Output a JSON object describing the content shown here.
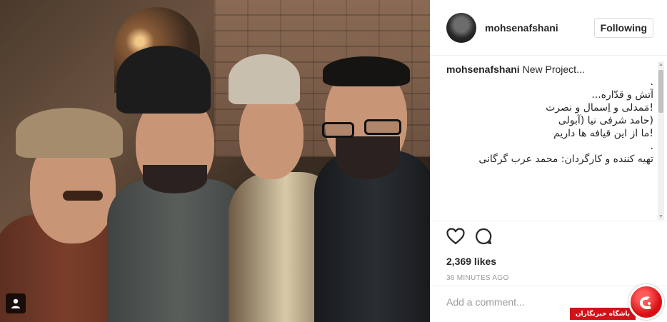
{
  "post": {
    "username": "mohsenafshani",
    "follow_label": "Following",
    "caption": {
      "author": "mohsenafshani",
      "intro": "New Project...",
      "lines": [
        ".",
        "آتش و قدّاره...",
        "!مَمدلی و اِسمال و نصرت",
        "(حامد شرفی نیا (آبولی",
        "!ما از این قیافه ها داریم",
        ".",
        "تهیه کننده و کارگردان: محمد عرب گرگانی"
      ]
    },
    "likes": "2,369 likes",
    "timestamp": "36 MINUTES AGO",
    "comment_placeholder": "Add a comment..."
  },
  "icons": {
    "like": "heart-icon",
    "comment": "comment-bubble-icon",
    "more": "more-options-icon",
    "user_tag": "user-tag-icon"
  },
  "watermark": {
    "text": "باشگاه خبرنگاران",
    "mark": "جـ"
  },
  "colors": {
    "watermark_red": "#d11218",
    "border": "#efefef",
    "muted": "#999999"
  }
}
